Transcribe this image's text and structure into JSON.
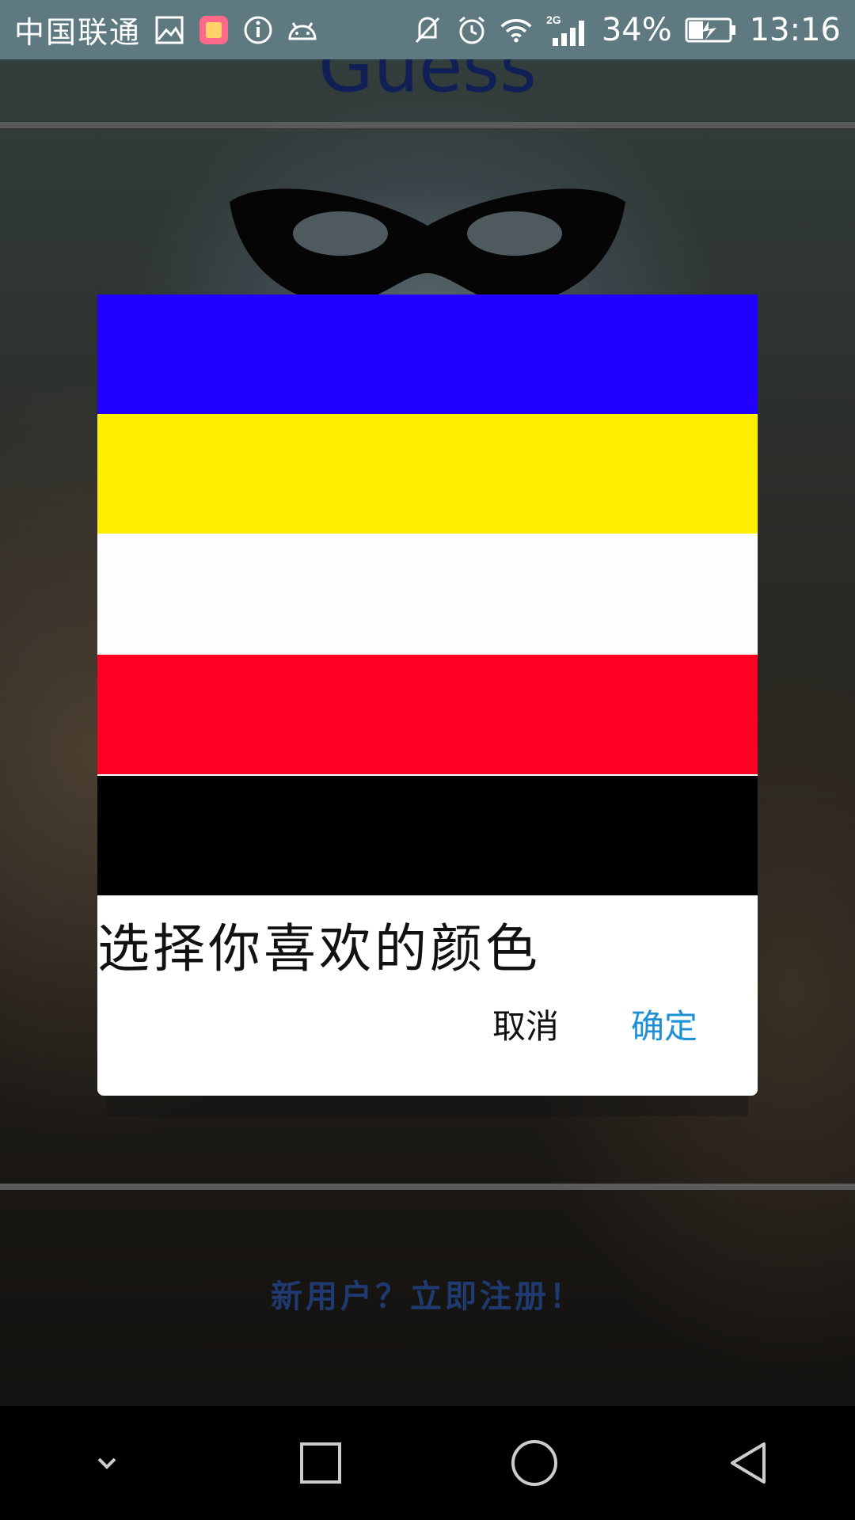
{
  "status_bar": {
    "carrier": "中国联通",
    "network": "2G",
    "battery": "34%",
    "time": "13:16",
    "icons": [
      "gallery-icon",
      "app-notification-icon",
      "info-icon",
      "android-icon",
      "mute-icon",
      "alarm-icon",
      "wifi-icon",
      "signal-icon",
      "battery-charging-icon"
    ]
  },
  "background_app": {
    "title": "Guess",
    "register_link": "新用户？立即注册！"
  },
  "dialog": {
    "color_options": [
      {
        "color": "#2200ff"
      },
      {
        "color": "#ffee00"
      },
      {
        "color": "#fdfdfb"
      },
      {
        "color": "#ff0022"
      },
      {
        "color": "#000000"
      }
    ],
    "message": "选择你喜欢的颜色",
    "cancel_label": "取消",
    "confirm_label": "确定",
    "confirm_color": "#1e90d6",
    "cancel_color": "#111111"
  },
  "nav_bar": {
    "buttons": [
      "hide-icon",
      "recents-icon",
      "home-icon",
      "back-icon"
    ]
  }
}
